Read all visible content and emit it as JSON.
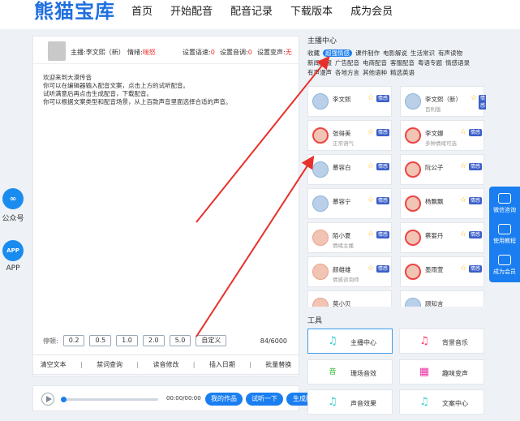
{
  "header": {
    "logo": "熊猫宝库",
    "nav": [
      "首页",
      "开始配音",
      "配音记录",
      "下载版本",
      "成为会员"
    ]
  },
  "side_left": {
    "wechat_label": "公众号",
    "app_badge": "APP",
    "app_label": "APP"
  },
  "editor": {
    "anchor_label": "主播:李文熙（新）",
    "emotion_label": "情绪:",
    "emotion_value": "喘怒",
    "speed_label": "设置语速:",
    "speed_value": "0",
    "volume_label": "设置音调:",
    "volume_value": "0",
    "pitch_label": "设置变声:",
    "pitch_value": "无",
    "intro_lines": [
      "欢迎来到大漠传音",
      "你可以在编辑器输入配音文案，点击上方的试听配音。",
      "试听满意后再点击生成配音，下载配音。",
      "你可以根据文案类型和配音场景，从上百款声音里面选择合适的声音。"
    ],
    "pause_label": "停顿:",
    "pause_options": [
      "0.2",
      "0.5",
      "1.0",
      "2.0",
      "5.0",
      "自定义"
    ],
    "char_count": "84/6000"
  },
  "footer_actions": [
    "清空文本",
    "禁词查询",
    "读音修改",
    "插入日期",
    "批量替换"
  ],
  "player": {
    "time": "00:00/00:00",
    "my_works": "我的作品",
    "preview": "试听一下",
    "generate": "生成配音",
    "progress": 0
  },
  "anchor_center": {
    "title": "主播中心",
    "tags": [
      "收藏",
      "超强情感",
      "课件制作",
      "电影解说",
      "生活常识",
      "有声读物",
      "新闻播报",
      "广告配音",
      "电商配音",
      "客服配音",
      "粤语专题",
      "情感语录",
      "有声漫声",
      "各地方言",
      "其他语种",
      "精选英语"
    ],
    "active_tag": "超强情感",
    "anchors": [
      {
        "name": "李文熙",
        "sub": "",
        "badge": "情感"
      },
      {
        "name": "李文熙（新）",
        "sub": "百利版",
        "badge": "情感"
      },
      {
        "name": "张得美",
        "sub": "正常语气",
        "badge": "情感"
      },
      {
        "name": "李文娜",
        "sub": "多种情绪可选",
        "badge": "情感"
      },
      {
        "name": "慕容白",
        "sub": "",
        "badge": "情感"
      },
      {
        "name": "阮公子",
        "sub": "",
        "badge": "情感"
      },
      {
        "name": "慕容宁",
        "sub": "",
        "badge": "情感"
      },
      {
        "name": "杨飘飘",
        "sub": "",
        "badge": "情感"
      },
      {
        "name": "陌小夏",
        "sub": "情绪主播",
        "badge": "情感"
      },
      {
        "name": "蔡婴丹",
        "sub": "",
        "badge": "情感"
      },
      {
        "name": "颜雄雄",
        "sub": "情感咨询师",
        "badge": "情感"
      },
      {
        "name": "墨雨萱",
        "sub": "",
        "badge": "情感"
      },
      {
        "name": "莫小贝",
        "sub": "",
        "badge": "情感"
      },
      {
        "name": "顾知言",
        "sub": "",
        "badge": "情感"
      }
    ]
  },
  "tools": {
    "title": "工具",
    "items": [
      "主播中心",
      "背景音乐",
      "珊场音效",
      "趣味变声",
      "声音效果",
      "文案中心"
    ],
    "glyph_yin": "音"
  },
  "float_bar": [
    "微信咨询",
    "使用教程",
    "成为会员"
  ],
  "colors": {
    "accent": "#1a7ef0",
    "arrow": "#e8302a",
    "emotion_badge": "#3b5fc9"
  }
}
